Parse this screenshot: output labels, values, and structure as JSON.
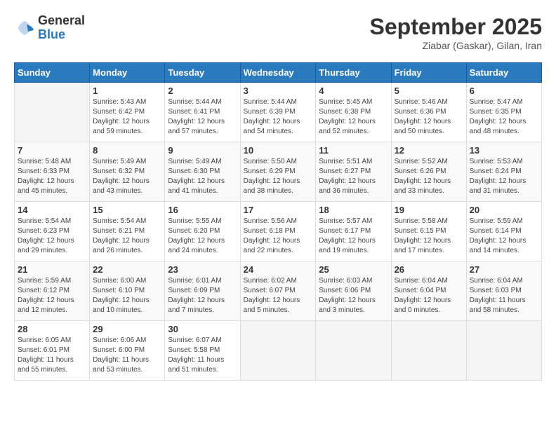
{
  "header": {
    "logo_general": "General",
    "logo_blue": "Blue",
    "month_title": "September 2025",
    "location": "Ziabar (Gaskar), Gilan, Iran"
  },
  "weekdays": [
    "Sunday",
    "Monday",
    "Tuesday",
    "Wednesday",
    "Thursday",
    "Friday",
    "Saturday"
  ],
  "weeks": [
    [
      {
        "day": "",
        "info": ""
      },
      {
        "day": "1",
        "info": "Sunrise: 5:43 AM\nSunset: 6:42 PM\nDaylight: 12 hours\nand 59 minutes."
      },
      {
        "day": "2",
        "info": "Sunrise: 5:44 AM\nSunset: 6:41 PM\nDaylight: 12 hours\nand 57 minutes."
      },
      {
        "day": "3",
        "info": "Sunrise: 5:44 AM\nSunset: 6:39 PM\nDaylight: 12 hours\nand 54 minutes."
      },
      {
        "day": "4",
        "info": "Sunrise: 5:45 AM\nSunset: 6:38 PM\nDaylight: 12 hours\nand 52 minutes."
      },
      {
        "day": "5",
        "info": "Sunrise: 5:46 AM\nSunset: 6:36 PM\nDaylight: 12 hours\nand 50 minutes."
      },
      {
        "day": "6",
        "info": "Sunrise: 5:47 AM\nSunset: 6:35 PM\nDaylight: 12 hours\nand 48 minutes."
      }
    ],
    [
      {
        "day": "7",
        "info": "Sunrise: 5:48 AM\nSunset: 6:33 PM\nDaylight: 12 hours\nand 45 minutes."
      },
      {
        "day": "8",
        "info": "Sunrise: 5:49 AM\nSunset: 6:32 PM\nDaylight: 12 hours\nand 43 minutes."
      },
      {
        "day": "9",
        "info": "Sunrise: 5:49 AM\nSunset: 6:30 PM\nDaylight: 12 hours\nand 41 minutes."
      },
      {
        "day": "10",
        "info": "Sunrise: 5:50 AM\nSunset: 6:29 PM\nDaylight: 12 hours\nand 38 minutes."
      },
      {
        "day": "11",
        "info": "Sunrise: 5:51 AM\nSunset: 6:27 PM\nDaylight: 12 hours\nand 36 minutes."
      },
      {
        "day": "12",
        "info": "Sunrise: 5:52 AM\nSunset: 6:26 PM\nDaylight: 12 hours\nand 33 minutes."
      },
      {
        "day": "13",
        "info": "Sunrise: 5:53 AM\nSunset: 6:24 PM\nDaylight: 12 hours\nand 31 minutes."
      }
    ],
    [
      {
        "day": "14",
        "info": "Sunrise: 5:54 AM\nSunset: 6:23 PM\nDaylight: 12 hours\nand 29 minutes."
      },
      {
        "day": "15",
        "info": "Sunrise: 5:54 AM\nSunset: 6:21 PM\nDaylight: 12 hours\nand 26 minutes."
      },
      {
        "day": "16",
        "info": "Sunrise: 5:55 AM\nSunset: 6:20 PM\nDaylight: 12 hours\nand 24 minutes."
      },
      {
        "day": "17",
        "info": "Sunrise: 5:56 AM\nSunset: 6:18 PM\nDaylight: 12 hours\nand 22 minutes."
      },
      {
        "day": "18",
        "info": "Sunrise: 5:57 AM\nSunset: 6:17 PM\nDaylight: 12 hours\nand 19 minutes."
      },
      {
        "day": "19",
        "info": "Sunrise: 5:58 AM\nSunset: 6:15 PM\nDaylight: 12 hours\nand 17 minutes."
      },
      {
        "day": "20",
        "info": "Sunrise: 5:59 AM\nSunset: 6:14 PM\nDaylight: 12 hours\nand 14 minutes."
      }
    ],
    [
      {
        "day": "21",
        "info": "Sunrise: 5:59 AM\nSunset: 6:12 PM\nDaylight: 12 hours\nand 12 minutes."
      },
      {
        "day": "22",
        "info": "Sunrise: 6:00 AM\nSunset: 6:10 PM\nDaylight: 12 hours\nand 10 minutes."
      },
      {
        "day": "23",
        "info": "Sunrise: 6:01 AM\nSunset: 6:09 PM\nDaylight: 12 hours\nand 7 minutes."
      },
      {
        "day": "24",
        "info": "Sunrise: 6:02 AM\nSunset: 6:07 PM\nDaylight: 12 hours\nand 5 minutes."
      },
      {
        "day": "25",
        "info": "Sunrise: 6:03 AM\nSunset: 6:06 PM\nDaylight: 12 hours\nand 3 minutes."
      },
      {
        "day": "26",
        "info": "Sunrise: 6:04 AM\nSunset: 6:04 PM\nDaylight: 12 hours\nand 0 minutes."
      },
      {
        "day": "27",
        "info": "Sunrise: 6:04 AM\nSunset: 6:03 PM\nDaylight: 11 hours\nand 58 minutes."
      }
    ],
    [
      {
        "day": "28",
        "info": "Sunrise: 6:05 AM\nSunset: 6:01 PM\nDaylight: 11 hours\nand 55 minutes."
      },
      {
        "day": "29",
        "info": "Sunrise: 6:06 AM\nSunset: 6:00 PM\nDaylight: 11 hours\nand 53 minutes."
      },
      {
        "day": "30",
        "info": "Sunrise: 6:07 AM\nSunset: 5:58 PM\nDaylight: 11 hours\nand 51 minutes."
      },
      {
        "day": "",
        "info": ""
      },
      {
        "day": "",
        "info": ""
      },
      {
        "day": "",
        "info": ""
      },
      {
        "day": "",
        "info": ""
      }
    ]
  ]
}
